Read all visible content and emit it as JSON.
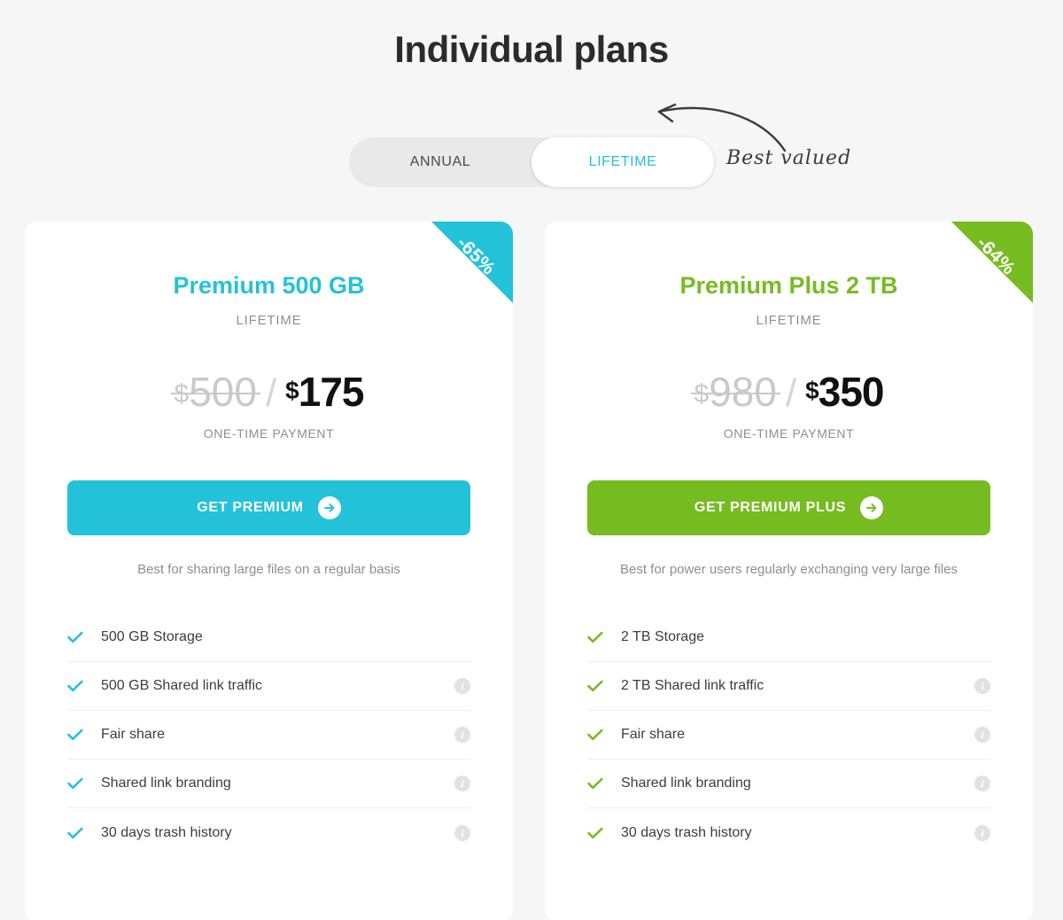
{
  "header": {
    "title": "Individual plans"
  },
  "billing_toggle": {
    "options": [
      {
        "label": "ANNUAL",
        "active": false
      },
      {
        "label": "LIFETIME",
        "active": true
      }
    ],
    "annotation": "Best valued"
  },
  "colors": {
    "premium": "#24c2d8",
    "premium_plus": "#76bc21",
    "page_background": "#f6f6f6",
    "card_background": "#ffffff",
    "price_old": "#c9c9c9",
    "price_new": "#111111",
    "muted_text": "#8e8e8e"
  },
  "plans": [
    {
      "name": "Premium 500 GB",
      "term": "LIFETIME",
      "discount_badge": "-65%",
      "price_old_currency": "$",
      "price_old": "500",
      "price_separator": "/",
      "price_new_currency": "$",
      "price_new": "175",
      "price_note": "ONE-TIME PAYMENT",
      "cta_label": "GET PREMIUM",
      "cta_icon": "arrow-right-circle-icon",
      "description": "Best for sharing large files on a regular basis",
      "features": [
        {
          "label": "500 GB Storage",
          "info": false
        },
        {
          "label": "500 GB Shared link traffic",
          "info": true
        },
        {
          "label": "Fair share",
          "info": true
        },
        {
          "label": "Shared link branding",
          "info": true
        },
        {
          "label": "30 days trash history",
          "info": true
        }
      ]
    },
    {
      "name": "Premium Plus 2 TB",
      "term": "LIFETIME",
      "discount_badge": "-64%",
      "price_old_currency": "$",
      "price_old": "980",
      "price_separator": "/",
      "price_new_currency": "$",
      "price_new": "350",
      "price_note": "ONE-TIME PAYMENT",
      "cta_label": "GET PREMIUM PLUS",
      "cta_icon": "arrow-right-circle-icon",
      "description": "Best for power users regularly exchanging very large files",
      "features": [
        {
          "label": "2 TB Storage",
          "info": false
        },
        {
          "label": "2 TB Shared link traffic",
          "info": true
        },
        {
          "label": "Fair share",
          "info": true
        },
        {
          "label": "Shared link branding",
          "info": true
        },
        {
          "label": "30 days trash history",
          "info": true
        }
      ]
    }
  ]
}
